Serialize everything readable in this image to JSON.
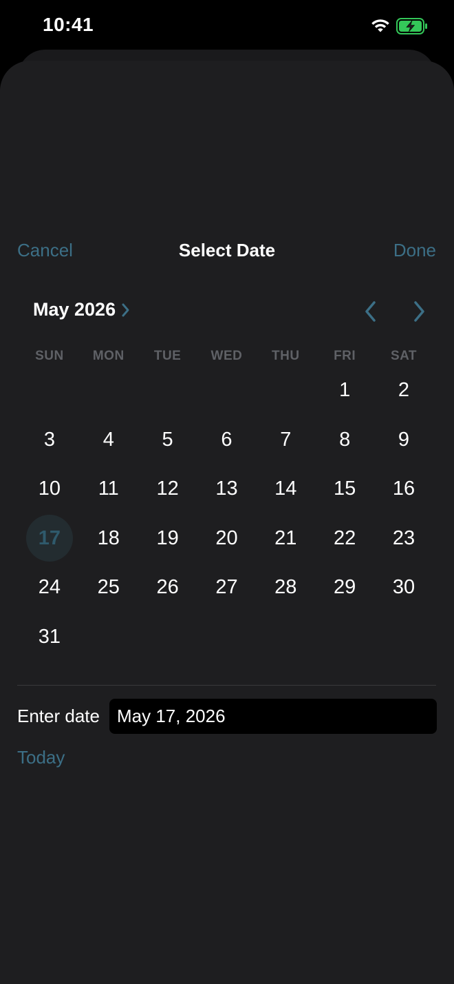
{
  "status_bar": {
    "time": "10:41"
  },
  "nav": {
    "cancel_label": "Cancel",
    "title": "Select Date",
    "done_label": "Done"
  },
  "calendar": {
    "month_label": "May 2026",
    "weekdays": [
      "SUN",
      "MON",
      "TUE",
      "WED",
      "THU",
      "FRI",
      "SAT"
    ],
    "weeks": [
      [
        "",
        "",
        "",
        "",
        "",
        "1",
        "2"
      ],
      [
        "3",
        "4",
        "5",
        "6",
        "7",
        "8",
        "9"
      ],
      [
        "10",
        "11",
        "12",
        "13",
        "14",
        "15",
        "16"
      ],
      [
        "17",
        "18",
        "19",
        "20",
        "21",
        "22",
        "23"
      ],
      [
        "24",
        "25",
        "26",
        "27",
        "28",
        "29",
        "30"
      ],
      [
        "31",
        "",
        "",
        "",
        "",
        "",
        ""
      ]
    ],
    "selected_day": "17"
  },
  "entry": {
    "label": "Enter date",
    "value": "May 17, 2026"
  },
  "today_label": "Today",
  "colors": {
    "accent": "#3c6f86",
    "sheet_background": "#1e1e20",
    "battery_green": "#34c759"
  },
  "icons": {
    "wifi": "wifi-icon",
    "battery": "battery-charging-icon",
    "month_picker": "chevron-right-icon",
    "prev": "chevron-left-icon",
    "next": "chevron-right-icon"
  }
}
